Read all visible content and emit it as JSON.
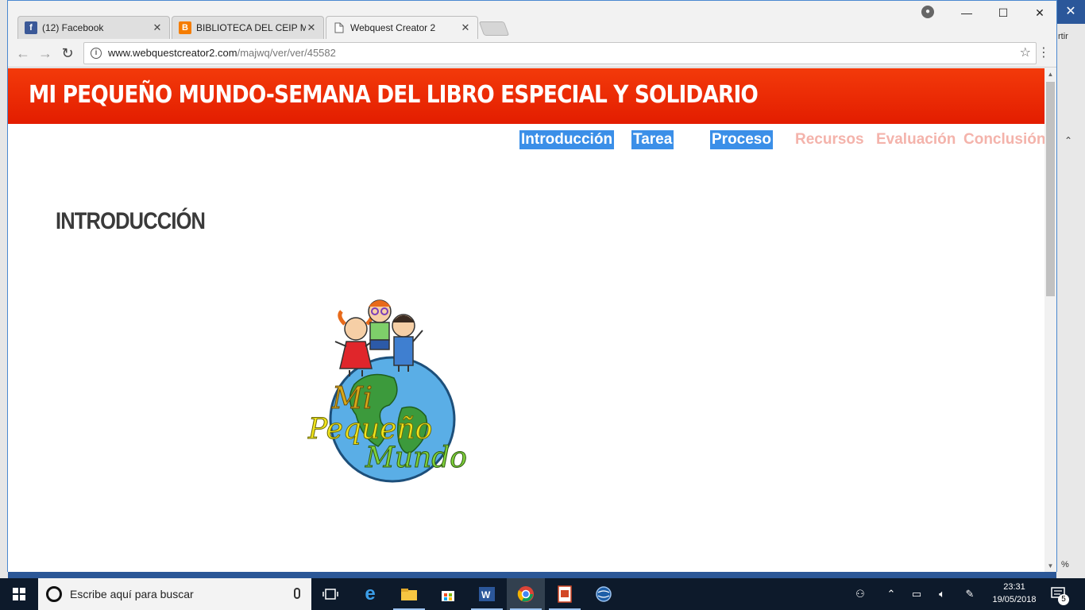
{
  "browser": {
    "tabs": [
      {
        "title": "(12) Facebook",
        "favicon": "facebook-icon",
        "favicon_color": "#3b5998",
        "active": false
      },
      {
        "title": "BIBLIOTECA DEL CEIP MERCEDES CARBÓ",
        "favicon": "blogger-icon",
        "favicon_color": "#f57d00",
        "active": false
      },
      {
        "title": "Webquest Creator 2",
        "favicon": "page-icon",
        "favicon_color": "#ffffff",
        "active": true
      }
    ],
    "close_glyph": "✕",
    "url_host": "www.webquestcreator2.com",
    "url_path": "/majwq/ver/ver/45582"
  },
  "page": {
    "header_title": "MI PEQUEÑO MUNDO-SEMANA DEL LIBRO ESPECIAL Y SOLIDARIO",
    "header_color": "#e82a00",
    "nav": [
      {
        "label": "Introducción",
        "highlighted": true
      },
      {
        "label": "Tarea",
        "highlighted": true
      },
      {
        "label": "Proceso",
        "highlighted": true
      },
      {
        "label": "Recursos",
        "highlighted": false
      },
      {
        "label": "Evaluación",
        "highlighted": false
      },
      {
        "label": "Conclusión",
        "highlighted": false
      }
    ],
    "section_title": "INTRODUCCIÓN",
    "image_text": {
      "line1": "Mi",
      "line2": "Pequeño",
      "line3": "Mundo"
    }
  },
  "background_app": {
    "partial_text": "rtir",
    "zoom_partial": "%"
  },
  "taskbar": {
    "search_placeholder": "Escribe aquí para buscar",
    "apps": [
      "task-view-icon",
      "edge-icon",
      "file-explorer-icon",
      "store-icon",
      "word-icon",
      "chrome-icon",
      "powerpoint-icon",
      "app-icon"
    ],
    "time": "23:31",
    "date": "19/05/2018",
    "notification_count": "5"
  }
}
